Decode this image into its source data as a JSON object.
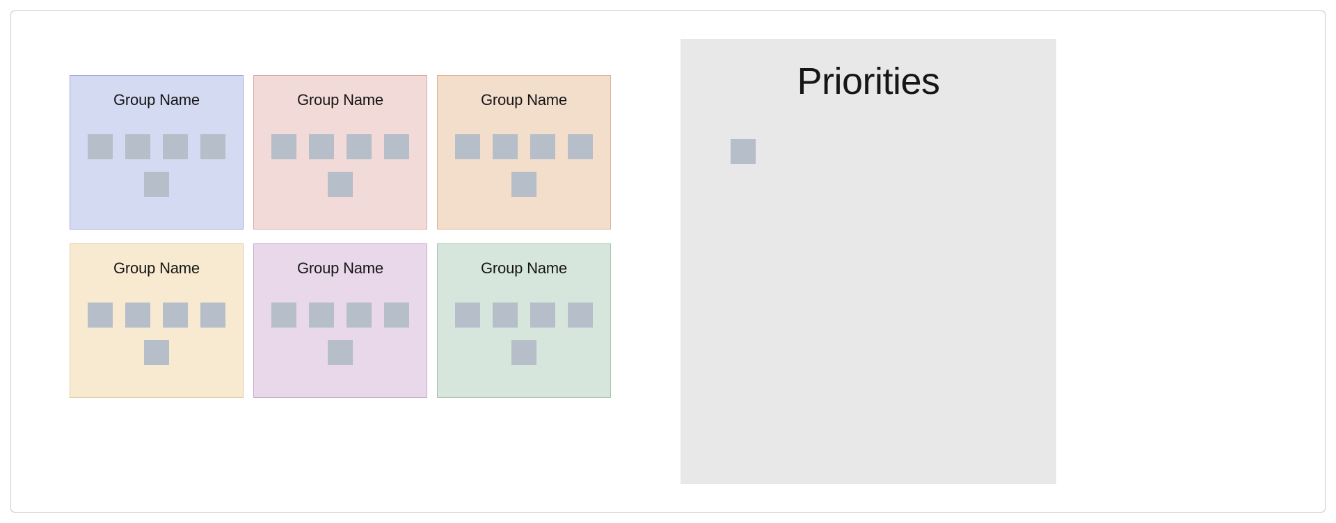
{
  "groups": [
    {
      "label": "Group Name",
      "tile_count": 5,
      "color": "blue"
    },
    {
      "label": "Group Name",
      "tile_count": 5,
      "color": "red"
    },
    {
      "label": "Group Name",
      "tile_count": 5,
      "color": "orange"
    },
    {
      "label": "Group Name",
      "tile_count": 5,
      "color": "yellow"
    },
    {
      "label": "Group Name",
      "tile_count": 5,
      "color": "purple"
    },
    {
      "label": "Group Name",
      "tile_count": 5,
      "color": "green"
    }
  ],
  "priorities": {
    "title": "Priorities",
    "tile_count": 1
  }
}
